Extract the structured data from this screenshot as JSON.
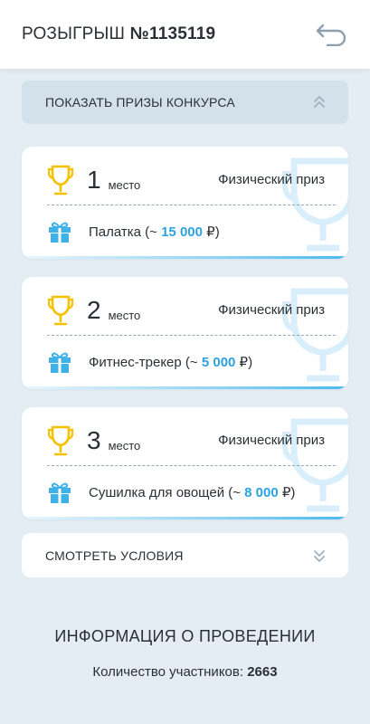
{
  "header": {
    "title_prefix": "РОЗЫГРЫШ",
    "title_number": "№1135119",
    "back_icon": "back-arrow-icon"
  },
  "show_prizes": {
    "label": "ПОКАЗАТЬ ПРИЗЫ КОНКУРСА",
    "icon": "chevron-up-double-icon"
  },
  "prizes": [
    {
      "place": "1",
      "place_word": "место",
      "type": "Физический приз",
      "name": "Палатка (~ ",
      "value": "15 000",
      "currency": " ₽)"
    },
    {
      "place": "2",
      "place_word": "место",
      "type": "Физический приз",
      "name": "Фитнес-трекер (~ ",
      "value": "5 000",
      "currency": " ₽)"
    },
    {
      "place": "3",
      "place_word": "место",
      "type": "Физический приз",
      "name": "Сушилка для овощей (~ ",
      "value": "8 000",
      "currency": " ₽)"
    }
  ],
  "conditions": {
    "label": "СМОТРЕТЬ УСЛОВИЯ",
    "icon": "chevron-down-double-icon"
  },
  "info": {
    "title": "ИНФОРМАЦИЯ О ПРОВЕДЕНИИ",
    "participants_label": "Количество участников: ",
    "participants_count": "2663"
  },
  "colors": {
    "accent": "#2ba3e0",
    "trophy": "#f5c000",
    "gift": "#3eb1e6",
    "background": "#e3edf3"
  }
}
